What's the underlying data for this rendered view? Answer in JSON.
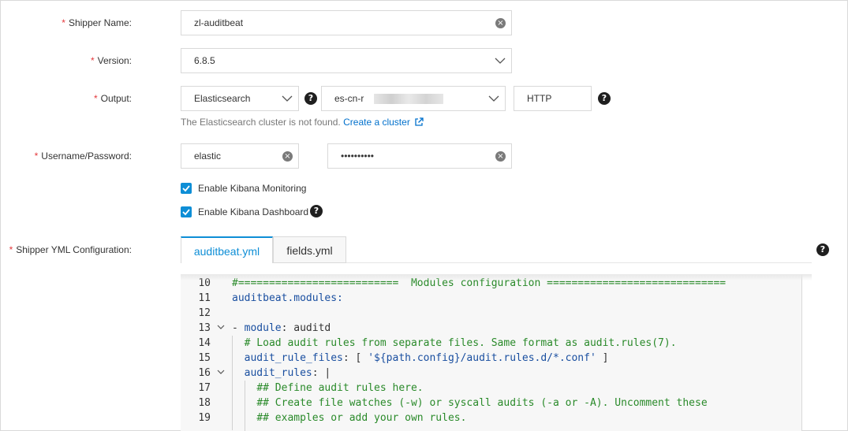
{
  "form": {
    "required_mark": "*",
    "shipper_name": {
      "label": "Shipper Name:",
      "value": "zl-auditbeat"
    },
    "version": {
      "label": "Version:",
      "value": "6.8.5"
    },
    "output": {
      "label": "Output:",
      "type_value": "Elasticsearch",
      "cluster_value": "es-cn-r",
      "protocol_value": "HTTP"
    },
    "hint": {
      "text": "The Elasticsearch cluster is not found.",
      "link": "Create a cluster"
    },
    "credentials": {
      "label": "Username/Password:",
      "username": "elastic",
      "password": "••••••••••"
    },
    "kibana_monitoring": {
      "label": "Enable Kibana Monitoring",
      "checked": true
    },
    "kibana_dashboard": {
      "label": "Enable Kibana Dashboard",
      "checked": true
    },
    "yml": {
      "label": "Shipper YML Configuration:",
      "tabs": [
        {
          "label": "auditbeat.yml",
          "active": true
        },
        {
          "label": "fields.yml",
          "active": false
        }
      ]
    }
  },
  "editor": {
    "lines": [
      {
        "n": "10",
        "fold": "",
        "indent": "",
        "parts": [
          {
            "t": "#==========================  Modules configuration =============================",
            "c": "cm"
          }
        ]
      },
      {
        "n": "11",
        "fold": "",
        "indent": "",
        "parts": [
          {
            "t": "auditbeat.modules:",
            "c": "kw"
          }
        ]
      },
      {
        "n": "12",
        "fold": "",
        "indent": "",
        "parts": []
      },
      {
        "n": "13",
        "fold": "v",
        "indent": "",
        "parts": [
          {
            "t": "- ",
            "c": ""
          },
          {
            "t": "module",
            "c": "kw"
          },
          {
            "t": ": auditd",
            "c": ""
          }
        ]
      },
      {
        "n": "14",
        "fold": "",
        "indent": "  ",
        "parts": [
          {
            "t": "# Load audit rules from separate files. Same format as audit.rules(7).",
            "c": "cm"
          }
        ]
      },
      {
        "n": "15",
        "fold": "",
        "indent": "  ",
        "parts": [
          {
            "t": "audit_rule_files",
            "c": "kw"
          },
          {
            "t": ": [ ",
            "c": ""
          },
          {
            "t": "'${path.config}/audit.rules.d/*.conf'",
            "c": "st"
          },
          {
            "t": " ]",
            "c": ""
          }
        ]
      },
      {
        "n": "16",
        "fold": "v",
        "indent": "  ",
        "parts": [
          {
            "t": "audit_rules",
            "c": "kw"
          },
          {
            "t": ": |",
            "c": ""
          }
        ]
      },
      {
        "n": "17",
        "fold": "",
        "indent": "    ",
        "parts": [
          {
            "t": "## Define audit rules here.",
            "c": "cm"
          }
        ]
      },
      {
        "n": "18",
        "fold": "",
        "indent": "    ",
        "parts": [
          {
            "t": "## Create file watches (-w) or syscall audits (-a or -A). Uncomment these",
            "c": "cm"
          }
        ]
      },
      {
        "n": "19",
        "fold": "",
        "indent": "    ",
        "parts": [
          {
            "t": "## examples or add your own rules.",
            "c": "cm"
          }
        ]
      }
    ]
  },
  "icons": {
    "clear": "clear-circle-icon",
    "chevron": "chevron-down-icon",
    "help": "help-circle-icon",
    "external": "external-link-icon",
    "check": "checkmark-icon"
  },
  "colors": {
    "accent": "#0e8ed6",
    "required": "#e4393c",
    "link": "#0070cc",
    "comment": "#2a8a2a",
    "keyword": "#1a4fa0"
  }
}
